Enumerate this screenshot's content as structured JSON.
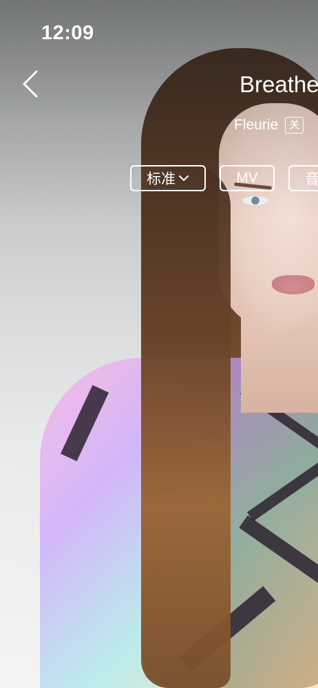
{
  "status_bar": {
    "time": "12:09"
  },
  "header": {
    "back_icon": "chevron-left-icon",
    "song_title": "Breathe",
    "artist": "Fleurie",
    "follow_label": "关"
  },
  "actions": {
    "quality_label": "标准",
    "quality_icon": "chevron-down-icon",
    "mv_label": "MV",
    "sound_label": "音"
  },
  "colors": {
    "overlay_text": "#ffffff",
    "background_grey": "#d8dadb"
  }
}
